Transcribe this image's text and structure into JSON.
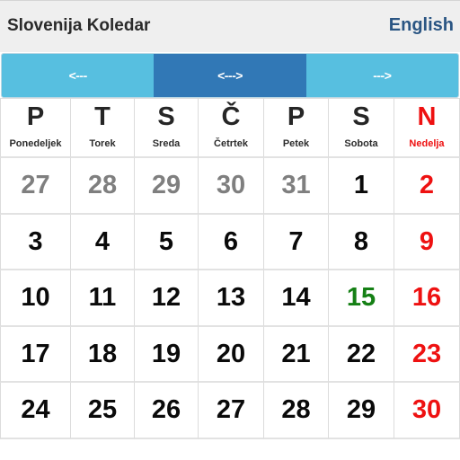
{
  "app": {
    "title": "Slovenija Koledar",
    "language_link": "English"
  },
  "nav": {
    "prev_label": "<---",
    "current_label": "<--->",
    "next_label": "--->"
  },
  "colors": {
    "nav_button": "#57bfe0",
    "nav_button_active": "#3178b6",
    "sunday": "#ee1111",
    "holiday": "#158015",
    "other_month": "#7f7f7f",
    "language_link": "#2a5583"
  },
  "weekdays": [
    {
      "letter": "P",
      "name": "Ponedeljek",
      "sunday": false
    },
    {
      "letter": "T",
      "name": "Torek",
      "sunday": false
    },
    {
      "letter": "S",
      "name": "Sreda",
      "sunday": false
    },
    {
      "letter": "Č",
      "name": "Četrtek",
      "sunday": false
    },
    {
      "letter": "P",
      "name": "Petek",
      "sunday": false
    },
    {
      "letter": "S",
      "name": "Sobota",
      "sunday": false
    },
    {
      "letter": "N",
      "name": "Nedelja",
      "sunday": true
    }
  ],
  "weeks": [
    [
      {
        "day": "27",
        "type": "other"
      },
      {
        "day": "28",
        "type": "other"
      },
      {
        "day": "29",
        "type": "other"
      },
      {
        "day": "30",
        "type": "other"
      },
      {
        "day": "31",
        "type": "other"
      },
      {
        "day": "1",
        "type": "normal"
      },
      {
        "day": "2",
        "type": "sunday"
      }
    ],
    [
      {
        "day": "3",
        "type": "normal"
      },
      {
        "day": "4",
        "type": "normal"
      },
      {
        "day": "5",
        "type": "normal"
      },
      {
        "day": "6",
        "type": "normal"
      },
      {
        "day": "7",
        "type": "normal"
      },
      {
        "day": "8",
        "type": "normal"
      },
      {
        "day": "9",
        "type": "sunday"
      }
    ],
    [
      {
        "day": "10",
        "type": "normal"
      },
      {
        "day": "11",
        "type": "normal"
      },
      {
        "day": "12",
        "type": "normal"
      },
      {
        "day": "13",
        "type": "normal"
      },
      {
        "day": "14",
        "type": "normal"
      },
      {
        "day": "15",
        "type": "holiday"
      },
      {
        "day": "16",
        "type": "sunday"
      }
    ],
    [
      {
        "day": "17",
        "type": "normal"
      },
      {
        "day": "18",
        "type": "normal"
      },
      {
        "day": "19",
        "type": "normal"
      },
      {
        "day": "20",
        "type": "normal"
      },
      {
        "day": "21",
        "type": "normal"
      },
      {
        "day": "22",
        "type": "normal"
      },
      {
        "day": "23",
        "type": "sunday"
      }
    ],
    [
      {
        "day": "24",
        "type": "normal"
      },
      {
        "day": "25",
        "type": "normal"
      },
      {
        "day": "26",
        "type": "normal"
      },
      {
        "day": "27",
        "type": "normal"
      },
      {
        "day": "28",
        "type": "normal"
      },
      {
        "day": "29",
        "type": "normal"
      },
      {
        "day": "30",
        "type": "sunday"
      }
    ]
  ]
}
